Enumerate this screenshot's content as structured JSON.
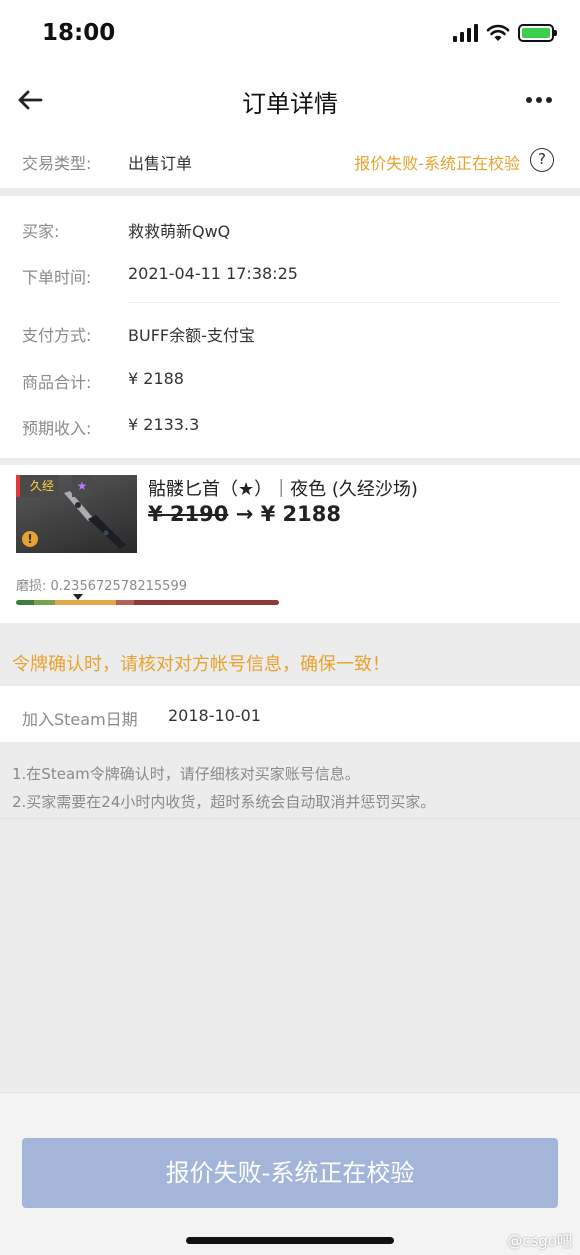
{
  "status_bar": {
    "time": "18:00"
  },
  "header": {
    "title": "订单详情"
  },
  "trade": {
    "type_label": "交易类型:",
    "type_value": "出售订单",
    "status": "报价失败-系统正在校验",
    "status_color": "#e8a22e"
  },
  "buyer": {
    "buyer_label": "买家:",
    "buyer_name": "救救萌新QwQ",
    "time_label": "下单时间:",
    "time_value": "2021-04-11 17:38:25",
    "payment_label": "支付方式:",
    "payment_value": "BUFF余额-支付宝",
    "total_label": "商品合计:",
    "total_value": "¥ 2188",
    "income_label": "预期收入:",
    "income_value": "¥ 2133.3"
  },
  "item": {
    "tag": "久经",
    "name": "骷髅匕首（★）｜夜色 (久经沙场)",
    "old_price": "¥ 2190",
    "arrow": "→",
    "new_price": "¥ 2188",
    "wear_label": "磨损: 0.235672578215599",
    "wear_value": 0.235672578215599
  },
  "notice": {
    "text": "令牌确认时，请核对对方帐号信息，确保一致！"
  },
  "steam": {
    "label": "加入Steam日期",
    "value": "2018-10-01"
  },
  "tips": [
    "1.在Steam令牌确认时，请仔细核对买家账号信息。",
    "2.买家需要在24小时内收货，超时系统会自动取消并惩罚买家。"
  ],
  "action": {
    "label": "报价失败-系统正在校验",
    "color": "#a3b6d9"
  },
  "watermark": {
    "text": "@csgo吧"
  }
}
